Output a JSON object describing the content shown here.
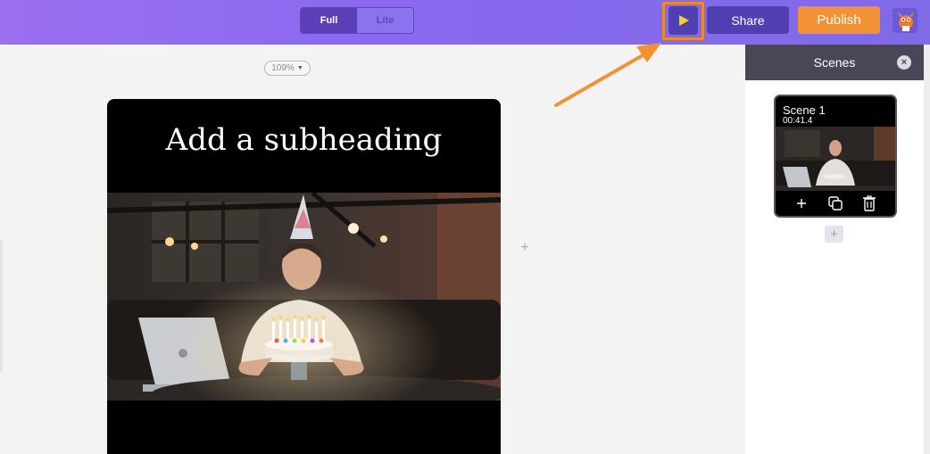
{
  "topbar": {
    "mode_toggle": {
      "full_label": "Full",
      "lite_label": "Lite",
      "selected": "Full"
    },
    "play_icon": "play-icon",
    "share_label": "Share",
    "publish_label": "Publish",
    "colors": {
      "accent": "#5b3fb8",
      "publish": "#f39234",
      "highlight": "#f08a24"
    }
  },
  "canvas": {
    "zoom_label": "109%",
    "subheading": "Add a subheading"
  },
  "scenes": {
    "header": "Scenes",
    "items": [
      {
        "title": "Scene 1",
        "duration": "00:41.4"
      }
    ]
  }
}
